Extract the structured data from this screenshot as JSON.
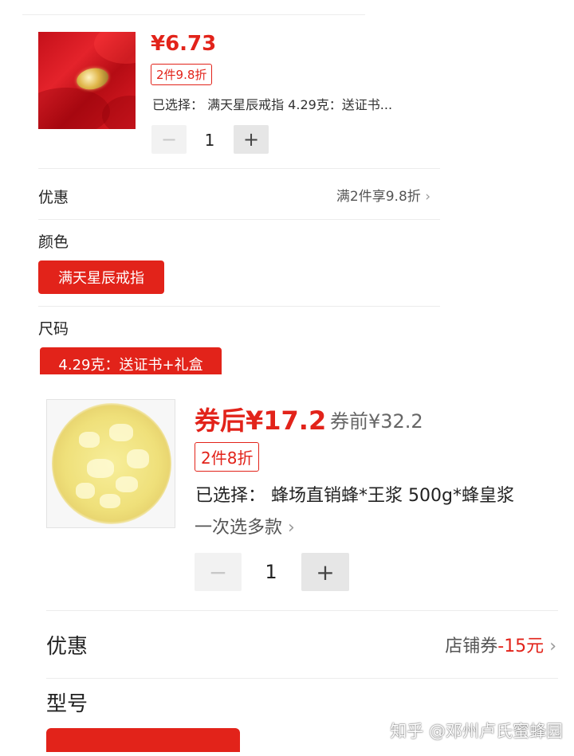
{
  "card1": {
    "price": "¥6.73",
    "discount_tag": "2件9.8折",
    "selected": "已选择： 满天星辰戒指 4.29克：送证书...",
    "qty_minus": "−",
    "qty_value": "1",
    "qty_plus": "+",
    "promo_label": "优惠",
    "promo_value": "满2件享9.8折",
    "color_label": "颜色",
    "color_option": "满天星辰戒指",
    "size_label": "尺码",
    "size_option": "4.29克：送证书+礼盒"
  },
  "card2": {
    "price_after": "券后¥17.2",
    "price_before": "券前¥32.2",
    "discount_tag": "2件8折",
    "selected": "已选择： 蜂场直销蜂*王浆 500g*蜂皇浆",
    "multi_select": "一次选多款",
    "qty_minus": "−",
    "qty_value": "1",
    "qty_plus": "+",
    "promo_label": "优惠",
    "promo_value_prefix": "店铺券",
    "promo_value_amount": "-15元",
    "model_label": "型号"
  },
  "chevron": "›",
  "watermark": "知乎 @邓州卢氏蜜蜂园",
  "colors": {
    "accent_red": "#e2231a",
    "divider": "#ececec",
    "button_gray": "#f2f2f2"
  },
  "icons": [
    "chevron-right-icon",
    "minus-icon",
    "plus-icon"
  ]
}
